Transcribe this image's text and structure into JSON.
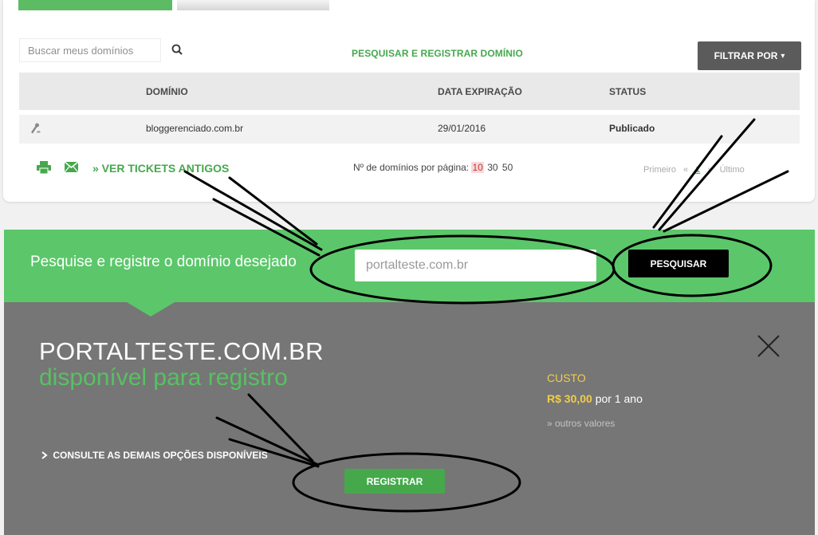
{
  "search": {
    "placeholder": "Buscar meus domínios"
  },
  "toolbar": {
    "register_link": "PESQUISAR E REGISTRAR DOMÍNIO",
    "filter_label": "FILTRAR POR",
    "filter_caret": "▾"
  },
  "table": {
    "headers": [
      "DOMÍNIO",
      "DATA EXPIRAÇÃO",
      "STATUS"
    ],
    "rows": [
      {
        "domain": "bloggerenciado.com.br",
        "expiration": "29/01/2016",
        "status": "Publicado"
      }
    ]
  },
  "footer": {
    "tickets_link": "» VER TICKETS ANTIGOS",
    "per_page_label": "Nº de domínios por página:",
    "per_page_options": [
      "10",
      "30",
      "50"
    ],
    "per_page_selected": "10",
    "pagination": {
      "first": "Primeiro",
      "prev": "«",
      "current": "1",
      "next": "»",
      "last": "Último"
    }
  },
  "band": {
    "prompt": "Pesquise e registre o domínio desejado",
    "input_value": "portalteste.com.br",
    "search_button": "PESQUISAR"
  },
  "result": {
    "domain": "PORTALTESTE.COM.BR",
    "status": "disponível para registro",
    "cost_label": "CUSTO",
    "price": "R$ 30,00",
    "period": "por 1 ano",
    "other_values": "» outros valores",
    "other_options": "CONSULTE AS DEMAIS OPÇÕES DISPONÍVEIS",
    "register_button": "REGISTRAR"
  },
  "colors": {
    "brand_green": "#5bc76a",
    "link_green": "#46a84d",
    "panel_gray": "#767676",
    "price_yellow": "#f2cd48"
  },
  "icons": [
    "search-icon",
    "domain-tool-icon",
    "print-icon",
    "mail-icon",
    "close-icon",
    "chevron-right-icon"
  ]
}
